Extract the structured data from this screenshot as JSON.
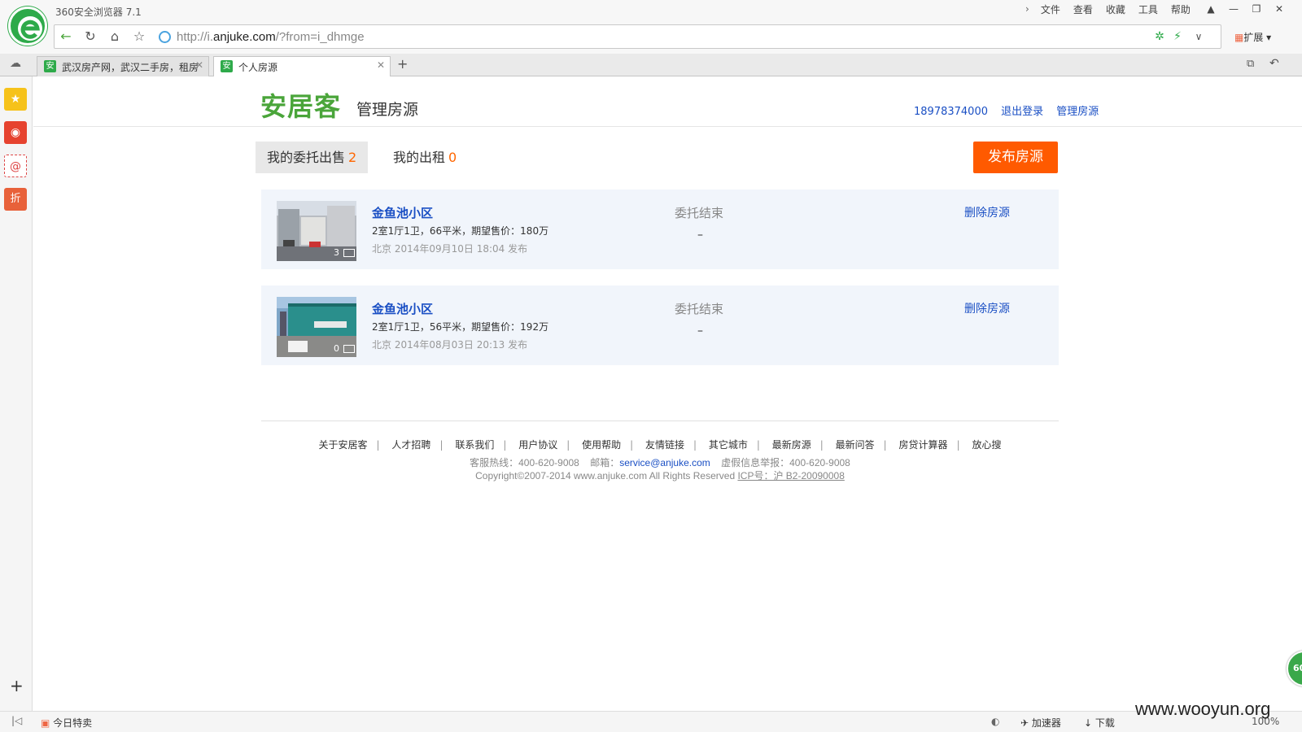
{
  "browser": {
    "title": "360安全浏览器 7.1",
    "menus": [
      "文件",
      "查看",
      "收藏",
      "工具",
      "帮助"
    ],
    "url_prefix": "http://i.",
    "url_domain": "anjuke.com",
    "url_suffix": "/?from=i_dhmge",
    "extensions_label": "扩展",
    "tabs": [
      {
        "label": "武汉房产网，武汉二手房，租房"
      },
      {
        "label": "个人房源"
      }
    ],
    "sidebar_today": "今日特卖",
    "status_accelerator": "加速器",
    "status_download": "下载",
    "zoom": "100%",
    "float_badge": "60"
  },
  "site": {
    "brand": "安居客",
    "brand_sub": "管理房源",
    "phone": "18978374000",
    "logout": "退出登录",
    "manage": "管理房源"
  },
  "tabs": [
    {
      "label": "我的委托出售",
      "count": "2"
    },
    {
      "label": "我的出租",
      "count": "0"
    }
  ],
  "publish_button": "发布房源",
  "listings": [
    {
      "name": "金鱼池小区",
      "desc": "2室1厅1卫，66平米，期望售价：180万",
      "date": "北京  2014年09月10日  18:04  发布",
      "photos": "3",
      "status": "委托结束",
      "status_detail": "–",
      "action": "删除房源"
    },
    {
      "name": "金鱼池小区",
      "desc": "2室1厅1卫，56平米，期望售价：192万",
      "date": "北京  2014年08月03日  20:13  发布",
      "photos": "0",
      "status": "委托结束",
      "status_detail": "–",
      "action": "删除房源"
    }
  ],
  "footer": {
    "links": [
      "关于安居客",
      "人才招聘",
      "联系我们",
      "用户协议",
      "使用帮助",
      "友情链接",
      "其它城市",
      "最新房源",
      "最新问答",
      "房贷计算器",
      "放心搜"
    ],
    "hotline": "客服热线：400-620-9008",
    "email_label": "邮箱：",
    "email": "service@anjuke.com",
    "report": "虚假信息举报：400-620-9008",
    "copyright": "Copyright©2007-2014 www.anjuke.com All Rights Reserved",
    "icp": "ICP号：沪 B2-20090008"
  },
  "watermark": "www.wooyun.org",
  "colors": {
    "brand_green": "#4aa53a",
    "accent_orange": "#ff5a00",
    "link_blue": "#1a4fc4"
  }
}
